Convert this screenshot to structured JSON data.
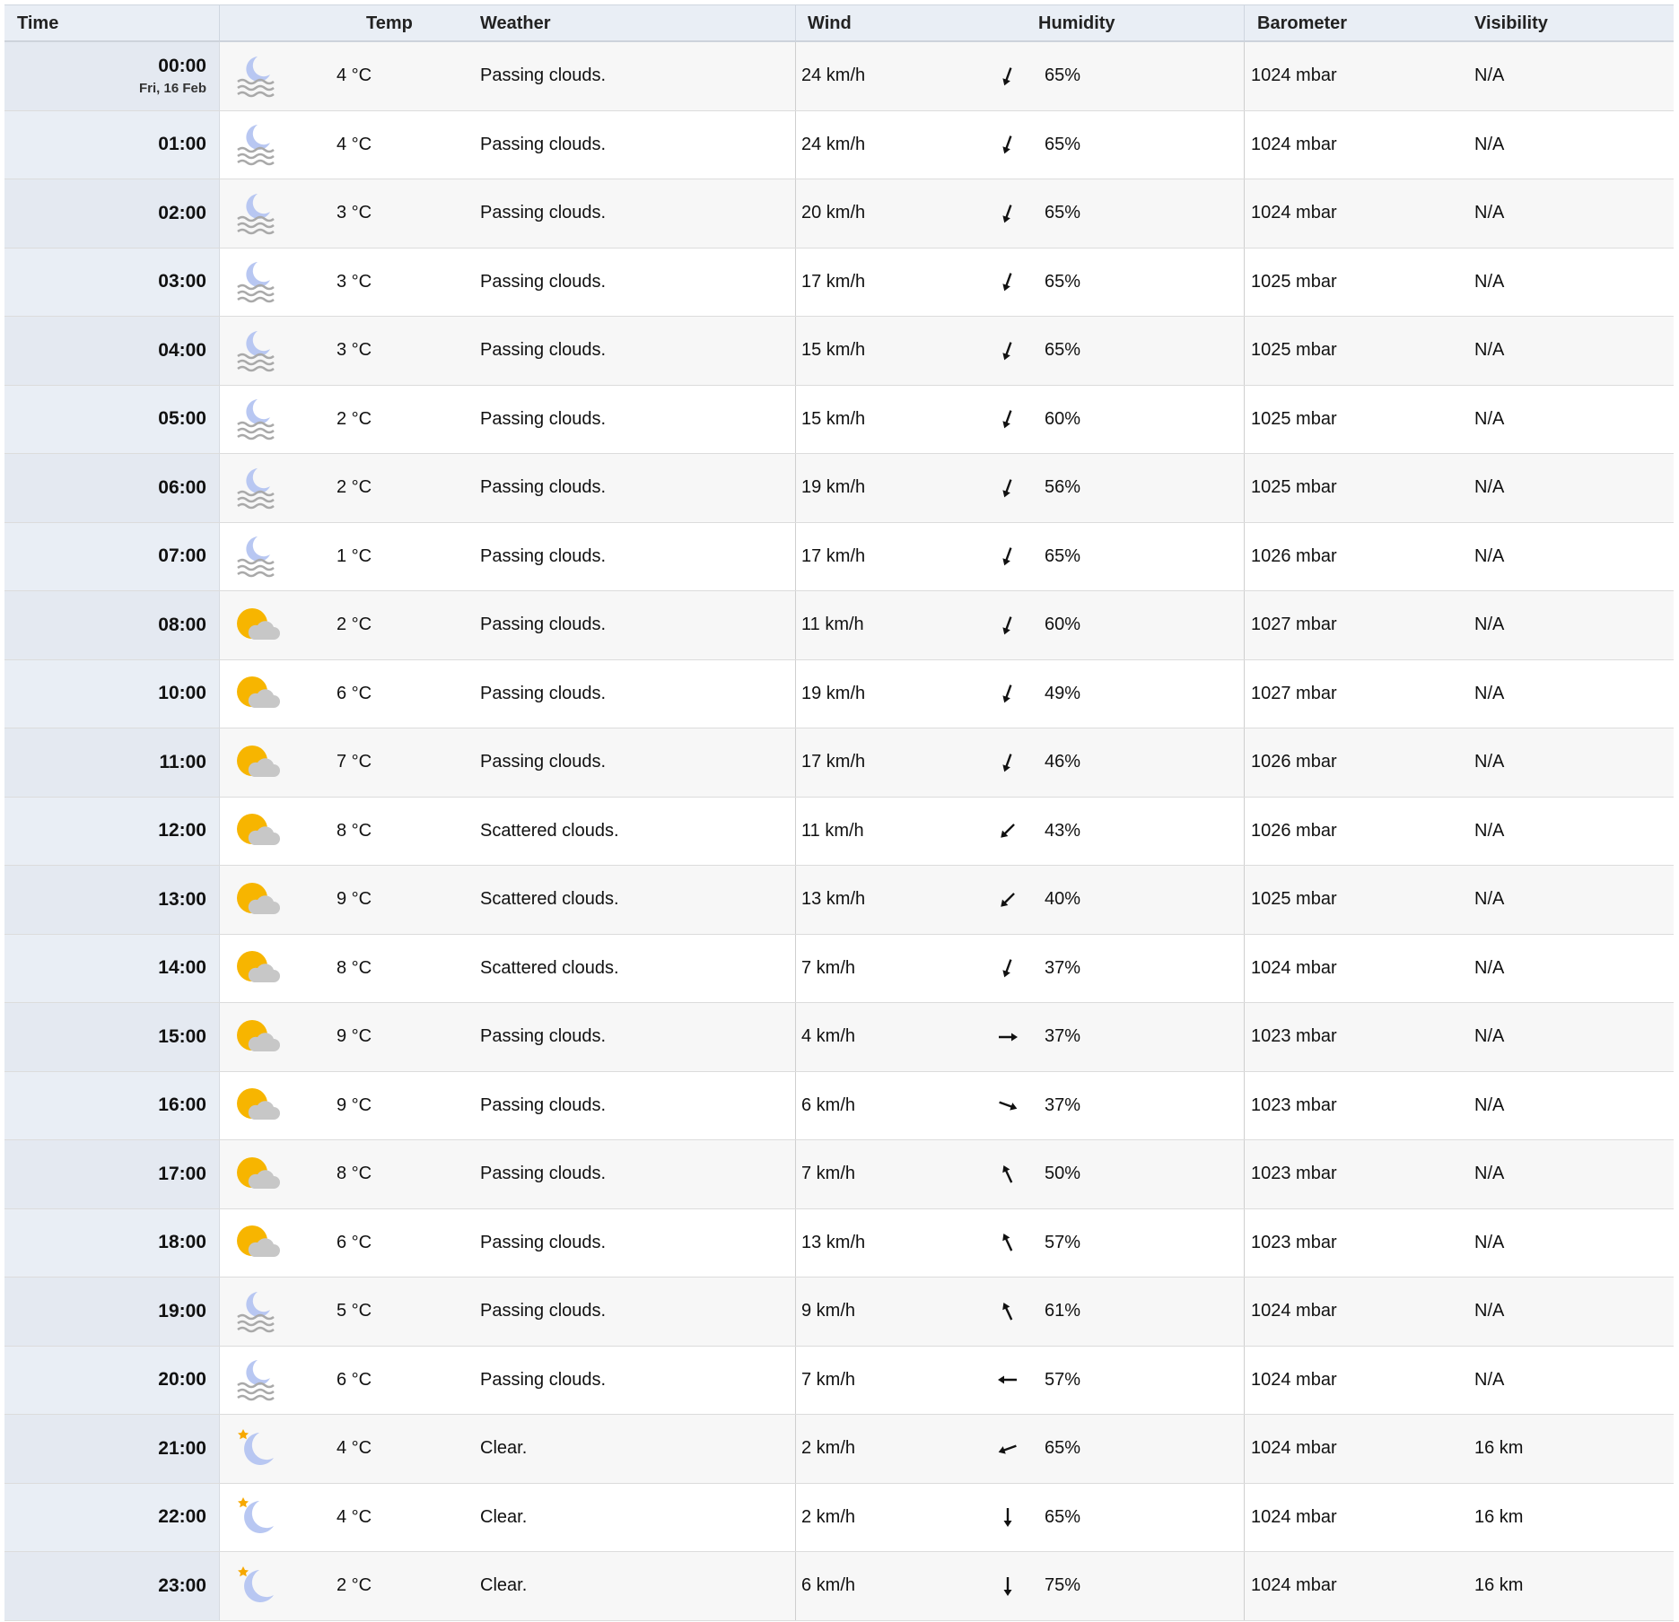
{
  "headers": {
    "time": "Time",
    "temp": "Temp",
    "weather": "Weather",
    "wind": "Wind",
    "humidity": "Humidity",
    "barometer": "Barometer",
    "visibility": "Visibility"
  },
  "colors": {
    "sun": "#f7b500",
    "moon": "#b8c7f2",
    "fog": "#a9a9a9",
    "cloud": "#c7c7c7",
    "star": "#f7a800"
  },
  "rows": [
    {
      "time": "00:00",
      "date": "Fri, 16 Feb",
      "icon": "moon-fog-icon",
      "temp": "4 °C",
      "weather": "Passing clouds.",
      "wind": "24 km/h",
      "wind_dir_deg": 200,
      "humidity": "65%",
      "barometer": "1024 mbar",
      "visibility": "N/A"
    },
    {
      "time": "01:00",
      "icon": "moon-fog-icon",
      "temp": "4 °C",
      "weather": "Passing clouds.",
      "wind": "24 km/h",
      "wind_dir_deg": 200,
      "humidity": "65%",
      "barometer": "1024 mbar",
      "visibility": "N/A"
    },
    {
      "time": "02:00",
      "icon": "moon-fog-icon",
      "temp": "3 °C",
      "weather": "Passing clouds.",
      "wind": "20 km/h",
      "wind_dir_deg": 200,
      "humidity": "65%",
      "barometer": "1024 mbar",
      "visibility": "N/A"
    },
    {
      "time": "03:00",
      "icon": "moon-fog-icon",
      "temp": "3 °C",
      "weather": "Passing clouds.",
      "wind": "17 km/h",
      "wind_dir_deg": 200,
      "humidity": "65%",
      "barometer": "1025 mbar",
      "visibility": "N/A"
    },
    {
      "time": "04:00",
      "icon": "moon-fog-icon",
      "temp": "3 °C",
      "weather": "Passing clouds.",
      "wind": "15 km/h",
      "wind_dir_deg": 200,
      "humidity": "65%",
      "barometer": "1025 mbar",
      "visibility": "N/A"
    },
    {
      "time": "05:00",
      "icon": "moon-fog-icon",
      "temp": "2 °C",
      "weather": "Passing clouds.",
      "wind": "15 km/h",
      "wind_dir_deg": 200,
      "humidity": "60%",
      "barometer": "1025 mbar",
      "visibility": "N/A"
    },
    {
      "time": "06:00",
      "icon": "moon-fog-icon",
      "temp": "2 °C",
      "weather": "Passing clouds.",
      "wind": "19 km/h",
      "wind_dir_deg": 200,
      "humidity": "56%",
      "barometer": "1025 mbar",
      "visibility": "N/A"
    },
    {
      "time": "07:00",
      "icon": "moon-fog-icon",
      "temp": "1 °C",
      "weather": "Passing clouds.",
      "wind": "17 km/h",
      "wind_dir_deg": 200,
      "humidity": "65%",
      "barometer": "1026 mbar",
      "visibility": "N/A"
    },
    {
      "time": "08:00",
      "icon": "sun-cloud-icon",
      "temp": "2 °C",
      "weather": "Passing clouds.",
      "wind": "11 km/h",
      "wind_dir_deg": 200,
      "humidity": "60%",
      "barometer": "1027 mbar",
      "visibility": "N/A"
    },
    {
      "time": "10:00",
      "icon": "sun-cloud-icon",
      "temp": "6 °C",
      "weather": "Passing clouds.",
      "wind": "19 km/h",
      "wind_dir_deg": 200,
      "humidity": "49%",
      "barometer": "1027 mbar",
      "visibility": "N/A"
    },
    {
      "time": "11:00",
      "icon": "sun-cloud-icon",
      "temp": "7 °C",
      "weather": "Passing clouds.",
      "wind": "17 km/h",
      "wind_dir_deg": 200,
      "humidity": "46%",
      "barometer": "1026 mbar",
      "visibility": "N/A"
    },
    {
      "time": "12:00",
      "icon": "sun-cloud-icon",
      "temp": "8 °C",
      "weather": "Scattered clouds.",
      "wind": "11 km/h",
      "wind_dir_deg": 225,
      "humidity": "43%",
      "barometer": "1026 mbar",
      "visibility": "N/A"
    },
    {
      "time": "13:00",
      "icon": "sun-cloud-icon",
      "temp": "9 °C",
      "weather": "Scattered clouds.",
      "wind": "13 km/h",
      "wind_dir_deg": 225,
      "humidity": "40%",
      "barometer": "1025 mbar",
      "visibility": "N/A"
    },
    {
      "time": "14:00",
      "icon": "sun-cloud-icon",
      "temp": "8 °C",
      "weather": "Scattered clouds.",
      "wind": "7 km/h",
      "wind_dir_deg": 200,
      "humidity": "37%",
      "barometer": "1024 mbar",
      "visibility": "N/A"
    },
    {
      "time": "15:00",
      "icon": "sun-cloud-icon",
      "temp": "9 °C",
      "weather": "Passing clouds.",
      "wind": "4 km/h",
      "wind_dir_deg": 90,
      "humidity": "37%",
      "barometer": "1023 mbar",
      "visibility": "N/A"
    },
    {
      "time": "16:00",
      "icon": "sun-cloud-icon",
      "temp": "9 °C",
      "weather": "Passing clouds.",
      "wind": "6 km/h",
      "wind_dir_deg": 110,
      "humidity": "37%",
      "barometer": "1023 mbar",
      "visibility": "N/A"
    },
    {
      "time": "17:00",
      "icon": "sun-cloud-icon",
      "temp": "8 °C",
      "weather": "Passing clouds.",
      "wind": "7 km/h",
      "wind_dir_deg": 335,
      "humidity": "50%",
      "barometer": "1023 mbar",
      "visibility": "N/A"
    },
    {
      "time": "18:00",
      "icon": "sun-cloud-icon",
      "temp": "6 °C",
      "weather": "Passing clouds.",
      "wind": "13 km/h",
      "wind_dir_deg": 335,
      "humidity": "57%",
      "barometer": "1023 mbar",
      "visibility": "N/A"
    },
    {
      "time": "19:00",
      "icon": "moon-fog-icon",
      "temp": "5 °C",
      "weather": "Passing clouds.",
      "wind": "9 km/h",
      "wind_dir_deg": 335,
      "humidity": "61%",
      "barometer": "1024 mbar",
      "visibility": "N/A"
    },
    {
      "time": "20:00",
      "icon": "moon-fog-icon",
      "temp": "6 °C",
      "weather": "Passing clouds.",
      "wind": "7 km/h",
      "wind_dir_deg": 270,
      "humidity": "57%",
      "barometer": "1024 mbar",
      "visibility": "N/A"
    },
    {
      "time": "21:00",
      "icon": "moon-star-icon",
      "temp": "4 °C",
      "weather": "Clear.",
      "wind": "2 km/h",
      "wind_dir_deg": 250,
      "humidity": "65%",
      "barometer": "1024 mbar",
      "visibility": "16 km"
    },
    {
      "time": "22:00",
      "icon": "moon-star-icon",
      "temp": "4 °C",
      "weather": "Clear.",
      "wind": "2 km/h",
      "wind_dir_deg": 180,
      "humidity": "65%",
      "barometer": "1024 mbar",
      "visibility": "16 km"
    },
    {
      "time": "23:00",
      "icon": "moon-star-icon",
      "temp": "2 °C",
      "weather": "Clear.",
      "wind": "6 km/h",
      "wind_dir_deg": 180,
      "humidity": "75%",
      "barometer": "1024 mbar",
      "visibility": "16 km"
    }
  ]
}
